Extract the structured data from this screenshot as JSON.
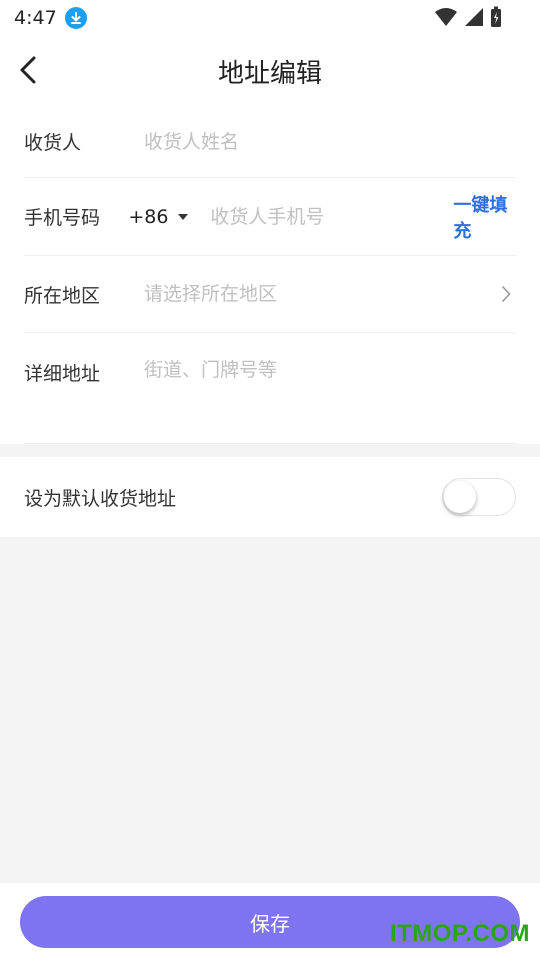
{
  "status_bar": {
    "time": "4:47"
  },
  "header": {
    "title": "地址编辑"
  },
  "form": {
    "recipient": {
      "label": "收货人",
      "placeholder": "收货人姓名"
    },
    "phone": {
      "label": "手机号码",
      "country_code": "+86",
      "placeholder": "收货人手机号",
      "quick_fill": "一键填充"
    },
    "region": {
      "label": "所在地区",
      "placeholder": "请选择所在地区"
    },
    "detail": {
      "label": "详细地址",
      "placeholder": "街道、门牌号等"
    }
  },
  "default_toggle": {
    "label": "设为默认收货地址",
    "on": false
  },
  "footer": {
    "save_label": "保存"
  },
  "watermark": "ITMOP.COM",
  "colors": {
    "accent": "#7f74f0",
    "link": "#2f6fe0",
    "download_badge": "#1aa0f5",
    "watermark": "#2ca41a"
  },
  "icons": [
    "download-icon",
    "wifi-icon",
    "signal-icon",
    "battery-icon",
    "back-arrow-icon",
    "chevron-right-icon",
    "caret-down-icon"
  ]
}
